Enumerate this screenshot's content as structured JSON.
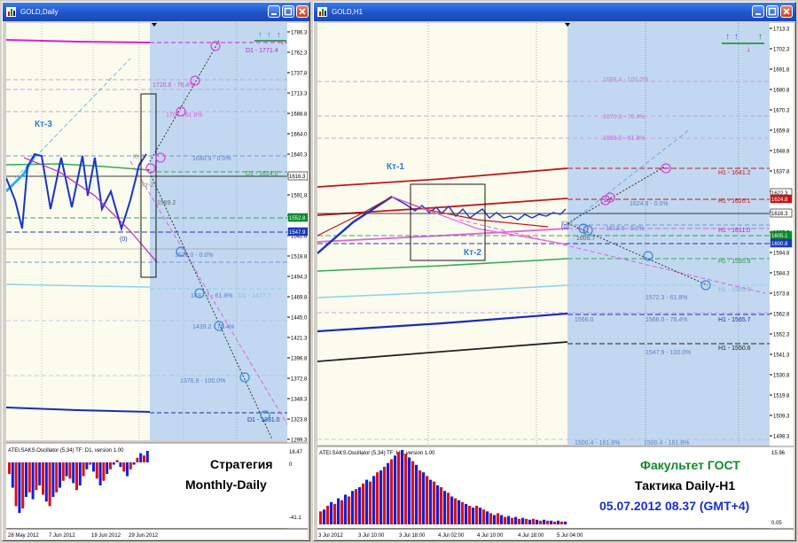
{
  "windows": {
    "daily": {
      "title": "GOLD,Daily",
      "price_ticks": [
        "1786.3",
        "1762.3",
        "1737.8",
        "1713.3",
        "1688.8",
        "1664.0",
        "1640.3",
        "1616.3",
        "1591.8",
        "1567.3",
        "1542.8",
        "1518.8",
        "1494.3",
        "1469.8",
        "1445.0",
        "1421.3",
        "1396.8",
        "1372.8",
        "1348.3",
        "1323.8",
        "1299.3"
      ],
      "price_tags": {
        "a": "1616.3",
        "b": "1552.8",
        "c": "1547.9"
      },
      "level_labels": [
        "D1 - 1771.4",
        "1720.8 - 76.4%",
        "1707 - 61.8%",
        "1640.9 - 0.0%",
        "D1 - 1624.0",
        "1589.2",
        "1526.0 - 0.0%",
        "1497.7 - 61.8%",
        "D1 - 1477.7",
        "1439.2 - 76.4%",
        "1376.9 - 100.0%",
        "D1 - 1331.0"
      ],
      "annotations": {
        "kt3": "Кт-3",
        "kt1": "Кт-1",
        "kt2": "Кт-2",
        "zero": "(0)"
      },
      "osc_title": "ATEI.SAKS.Oscillator (5,34) TF: D1, version 1.00",
      "osc_ticks": {
        "top": "16.47",
        "mid": "0",
        "bottom": "-41.1"
      },
      "time_ticks": [
        "28 May 2012",
        "7 Jun 2012",
        "19 Jun 2012",
        "29 Jun 2012"
      ],
      "overlay": {
        "line1": "Стратегия",
        "line2": "Monthly-Daily"
      },
      "osc_bars": [
        -10,
        -22,
        -38,
        -44,
        -40,
        -30,
        -26,
        -32,
        -24,
        -20,
        -28,
        -34,
        -38,
        -30,
        -26,
        -22,
        -16,
        -12,
        -14,
        -18,
        -24,
        -20,
        -12,
        -6,
        -2,
        -8,
        -14,
        -20,
        -16,
        -10,
        -6,
        -2,
        2,
        -4,
        -8,
        -12,
        -6,
        -2,
        4,
        8,
        6,
        10
      ]
    },
    "h1": {
      "title": "GOLD,H1",
      "price_ticks": [
        "1713.3",
        "1702.3",
        "1691.8",
        "1680.8",
        "1670.3",
        "1659.8",
        "1648.8",
        "1637.8",
        "1627.3",
        "1616.3",
        "1605.3",
        "1594.8",
        "1584.3",
        "1573.8",
        "1562.8",
        "1552.3",
        "1541.3",
        "1530.8",
        "1519.8",
        "1509.3",
        "1498.3"
      ],
      "price_tags": {
        "a": "1624.8",
        "b": "1616.3",
        "c": "1605.1",
        "d": "1600.8",
        "e": "1622.3"
      },
      "level_labels": [
        "1688.4 - 100.0%",
        "1670.3 - 76.4%",
        "1659.0 - 61.8%",
        "H1 - 1641.2",
        "H1 - 1626.1",
        "1624.8 - 0.0%",
        "1613.8 - 0.0%",
        "1606.7",
        "H1 - 1611.0",
        "H1 - 1595.9",
        "H1 - 1580.5",
        "1572.3 - 61.8%",
        "1566.0",
        "1566.0 - 76.4%",
        "H1 - 1565.7",
        "1547.9 - 100.0%",
        "H1 - 1550.6",
        "1500.4 - 161.8%",
        "1500.4 - 161.8%"
      ],
      "annotations": {
        "kt1": "Кт-1",
        "kt2": "Кт-2",
        "kt2b": "Кт-2",
        "zero": "(0)"
      },
      "osc_title": "ATEI.SAKS.Oscillator (5,34) TF: H1, version 1.00",
      "osc_ticks": {
        "top": "15.96",
        "bottom": "0.05"
      },
      "time_ticks": [
        "3 Jul 2012",
        "3 Jul 10:00",
        "3 Jul 18:00",
        "4 Jul 02:00",
        "4 Jul 10:00",
        "4 Jul 18:00",
        "5 Jul 04:00"
      ],
      "overlay": {
        "line1": "Факультет ГОСТ",
        "line2": "Тактика Daily-H1",
        "line3": "05.07.2012  08.37 (GMT+4)"
      },
      "osc_bars": [
        14,
        16,
        20,
        24,
        22,
        28,
        26,
        32,
        30,
        36,
        38,
        40,
        44,
        48,
        46,
        52,
        56,
        58,
        62,
        66,
        70,
        74,
        78,
        80,
        76,
        72,
        68,
        64,
        58,
        56,
        52,
        48,
        46,
        42,
        40,
        36,
        34,
        30,
        28,
        26,
        24,
        22,
        20,
        18,
        20,
        18,
        16,
        14,
        12,
        10,
        12,
        10,
        8,
        9,
        7,
        8,
        6,
        7,
        6,
        5,
        6,
        5,
        4,
        5,
        4,
        4,
        3,
        4,
        3,
        3
      ]
    }
  },
  "colors": {
    "daily_plot_bg": "#fbfbee",
    "future_bg": "#c2d8f0",
    "h1_plot_bg": "#fbfbee",
    "title_bar": "#2860d8",
    "candle_line": "#1535c8",
    "kt_label": "#2a7dd8",
    "fib_magenta": "#e060e0",
    "overlay_green": "#128a2a",
    "overlay_blue": "#1830c8"
  }
}
